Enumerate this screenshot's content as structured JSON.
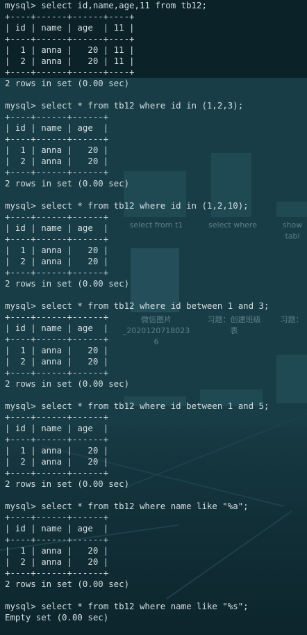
{
  "background": {
    "colors": {
      "terminal": "#0e2a31",
      "text": "#d6dee0"
    },
    "thumbnail_captions": [
      "select from t1",
      "select where",
      "show\ntabl",
      "微信图片\n_2020120718023\n6",
      "习题：创建班级\n表",
      "习题："
    ]
  },
  "terminal": {
    "lines": [
      "mysql> select id,name,age,11 from tb12;",
      "+----+------+------+----+",
      "| id | name | age  | 11 |",
      "+----+------+------+----+",
      "|  1 | anna |   20 | 11 |",
      "|  2 | anna |   20 | 11 |",
      "+----+------+------+----+",
      "2 rows in set (0.00 sec)",
      "",
      "mysql> select * from tb12 where id in (1,2,3);",
      "+----+------+------+",
      "| id | name | age  |",
      "+----+------+------+",
      "|  1 | anna |   20 |",
      "|  2 | anna |   20 |",
      "+----+------+------+",
      "2 rows in set (0.00 sec)",
      "",
      "mysql> select * from tb12 where id in (1,2,10);",
      "+----+------+------+",
      "| id | name | age  |",
      "+----+------+------+",
      "|  1 | anna |   20 |",
      "|  2 | anna |   20 |",
      "+----+------+------+",
      "2 rows in set (0.00 sec)",
      "",
      "mysql> select * from tb12 where id between 1 and 3;",
      "+----+------+------+",
      "| id | name | age  |",
      "+----+------+------+",
      "|  1 | anna |   20 |",
      "|  2 | anna |   20 |",
      "+----+------+------+",
      "2 rows in set (0.00 sec)",
      "",
      "mysql> select * from tb12 where id between 1 and 5;",
      "+----+------+------+",
      "| id | name | age  |",
      "+----+------+------+",
      "|  1 | anna |   20 |",
      "|  2 | anna |   20 |",
      "+----+------+------+",
      "2 rows in set (0.00 sec)",
      "",
      "mysql> select * from tb12 where name like \"%a\";",
      "+----+------+------+",
      "| id | name | age  |",
      "+----+------+------+",
      "|  1 | anna |   20 |",
      "|  2 | anna |   20 |",
      "+----+------+------+",
      "2 rows in set (0.00 sec)",
      "",
      "mysql> select * from tb12 where name like \"%s\";",
      "Empty set (0.00 sec)"
    ]
  }
}
